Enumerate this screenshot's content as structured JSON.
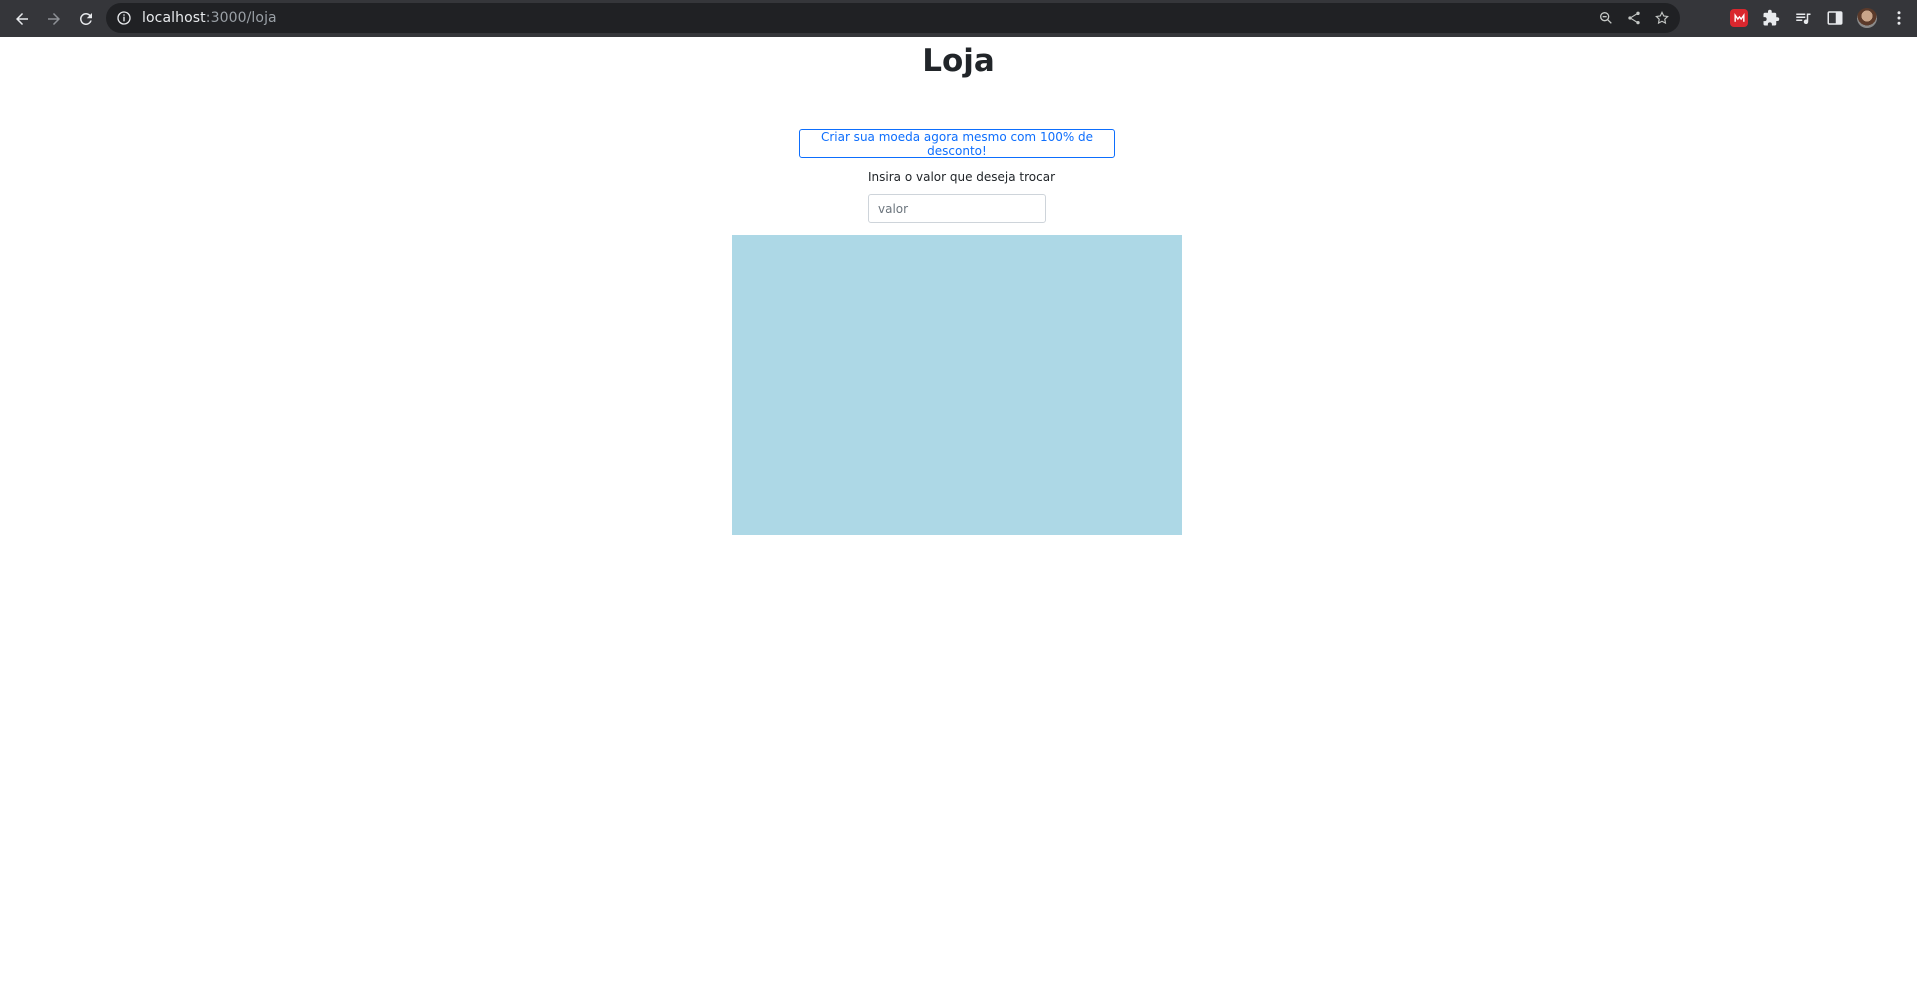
{
  "browser": {
    "url_host": "localhost",
    "url_rest": ":3000/loja",
    "colors": {
      "toolbar": "#35363a",
      "omnibox": "#202124"
    },
    "icons": [
      "back-arrow-icon",
      "forward-arrow-icon",
      "reload-icon",
      "info-icon",
      "zoom-icon",
      "share-icon",
      "star-icon",
      "mega-extension-icon",
      "extensions-puzzle-icon",
      "media-queue-icon",
      "side-panel-icon",
      "profile-avatar",
      "kebab-menu-icon"
    ]
  },
  "page": {
    "title": "Loja",
    "promo_button_label": "Criar sua moeda agora mesmo com 100% de desconto!",
    "input_label": "Insira o valor que deseja trocar",
    "input_placeholder": "valor",
    "input_value": "",
    "colors": {
      "accent": "#0d6efd",
      "panel": "#add8e6"
    }
  }
}
